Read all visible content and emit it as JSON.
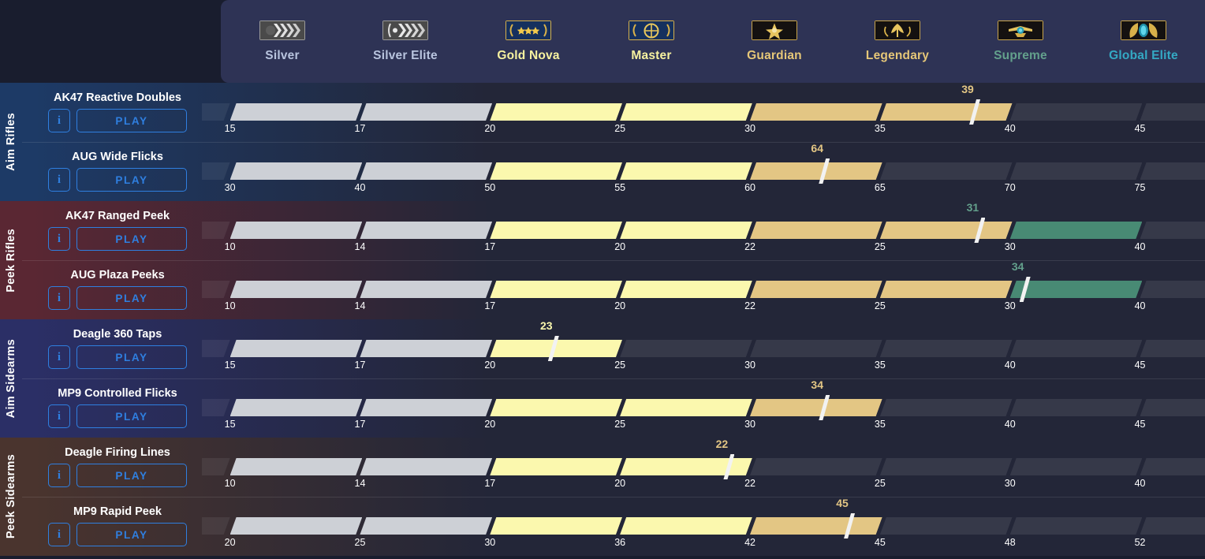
{
  "header": {
    "ranks": [
      {
        "label": "Silver",
        "color": "#b8c4de",
        "badge": "silver-badge"
      },
      {
        "label": "Silver Elite",
        "color": "#b8c4de",
        "badge": "silver-elite-badge"
      },
      {
        "label": "Gold Nova",
        "color": "#f7f2a0",
        "badge": "gold-nova-badge"
      },
      {
        "label": "Master",
        "color": "#f7f2a0",
        "badge": "master-guardian-badge"
      },
      {
        "label": "Guardian",
        "color": "#e6c778",
        "badge": "guardian-badge"
      },
      {
        "label": "Legendary",
        "color": "#e6c778",
        "badge": "legendary-badge"
      },
      {
        "label": "Supreme",
        "color": "#63a08c",
        "badge": "supreme-badge"
      },
      {
        "label": "Global Elite",
        "color": "#34a9c4",
        "badge": "global-elite-badge"
      }
    ]
  },
  "palette": {
    "silver": "#cdd0d6",
    "gold": "#fbf8ae",
    "guardian": "#e3c684",
    "supreme": "#488a74",
    "empty": "#3c4160",
    "marker": "#f2f2f2",
    "play_blue": "#2f7fe0"
  },
  "buttons": {
    "info_label": "i",
    "play_label": "PLAY"
  },
  "groups": [
    {
      "name": "Aim Rifles",
      "accent": "#1d3a66",
      "rows": [
        {
          "title": "AK47 Reactive Doubles",
          "value": "39",
          "value_color": "#e3c684",
          "ticks": [
            "15",
            "17",
            "20",
            "25",
            "30",
            "35",
            "40",
            "45"
          ],
          "fills": [
            "silver",
            "silver",
            "gold",
            "gold",
            "guardian",
            "guardian",
            "empty",
            "empty"
          ],
          "marker_pct": 76.5
        },
        {
          "title": "AUG Wide Flicks",
          "value": "64",
          "value_color": "#e3c684",
          "ticks": [
            "30",
            "40",
            "50",
            "55",
            "60",
            "65",
            "70",
            "75"
          ],
          "fills": [
            "silver",
            "silver",
            "gold",
            "gold",
            "guardian",
            "empty",
            "empty",
            "empty"
          ],
          "marker_pct": 61.5
        }
      ]
    },
    {
      "name": "Peek Rifles",
      "accent": "#5a2733",
      "rows": [
        {
          "title": "AK47 Ranged Peek",
          "value": "31",
          "value_color": "#63a08c",
          "ticks": [
            "10",
            "14",
            "17",
            "20",
            "22",
            "25",
            "30",
            "40"
          ],
          "fills": [
            "silver",
            "silver",
            "gold",
            "gold",
            "guardian",
            "guardian",
            "supreme",
            "empty"
          ],
          "marker_pct": 77.0
        },
        {
          "title": "AUG Plaza Peeks",
          "value": "34",
          "value_color": "#63a08c",
          "ticks": [
            "10",
            "14",
            "17",
            "20",
            "22",
            "25",
            "30",
            "40"
          ],
          "fills": [
            "silver",
            "silver",
            "gold",
            "gold",
            "guardian",
            "guardian",
            "supreme",
            "empty"
          ],
          "marker_pct": 81.5
        }
      ]
    },
    {
      "name": "Aim Sidearms",
      "accent": "#2b2f66",
      "rows": [
        {
          "title": "Deagle 360 Taps",
          "value": "23",
          "value_color": "#fbf8ae",
          "ticks": [
            "15",
            "17",
            "20",
            "25",
            "30",
            "35",
            "40",
            "45"
          ],
          "fills": [
            "silver",
            "silver",
            "gold",
            "empty",
            "empty",
            "empty",
            "empty",
            "empty"
          ],
          "marker_pct": 34.5
        },
        {
          "title": "MP9 Controlled Flicks",
          "value": "34",
          "value_color": "#e3c684",
          "ticks": [
            "15",
            "17",
            "20",
            "25",
            "30",
            "35",
            "40",
            "45"
          ],
          "fills": [
            "silver",
            "silver",
            "gold",
            "gold",
            "guardian",
            "empty",
            "empty",
            "empty"
          ],
          "marker_pct": 61.5
        }
      ]
    },
    {
      "name": "Peek Sidearms",
      "accent": "#4a342e",
      "rows": [
        {
          "title": "Deagle Firing Lines",
          "value": "22",
          "value_color": "#e3c684",
          "ticks": [
            "10",
            "14",
            "17",
            "20",
            "22",
            "25",
            "30",
            "40"
          ],
          "fills": [
            "silver",
            "silver",
            "gold",
            "gold",
            "empty",
            "empty",
            "empty",
            "empty"
          ],
          "marker_pct": 52.0
        },
        {
          "title": "MP9 Rapid Peek",
          "value": "45",
          "value_color": "#e3c684",
          "ticks": [
            "20",
            "25",
            "30",
            "36",
            "42",
            "45",
            "48",
            "52"
          ],
          "fills": [
            "silver",
            "silver",
            "gold",
            "gold",
            "guardian",
            "empty",
            "empty",
            "empty"
          ],
          "marker_pct": 64.0
        }
      ]
    }
  ]
}
